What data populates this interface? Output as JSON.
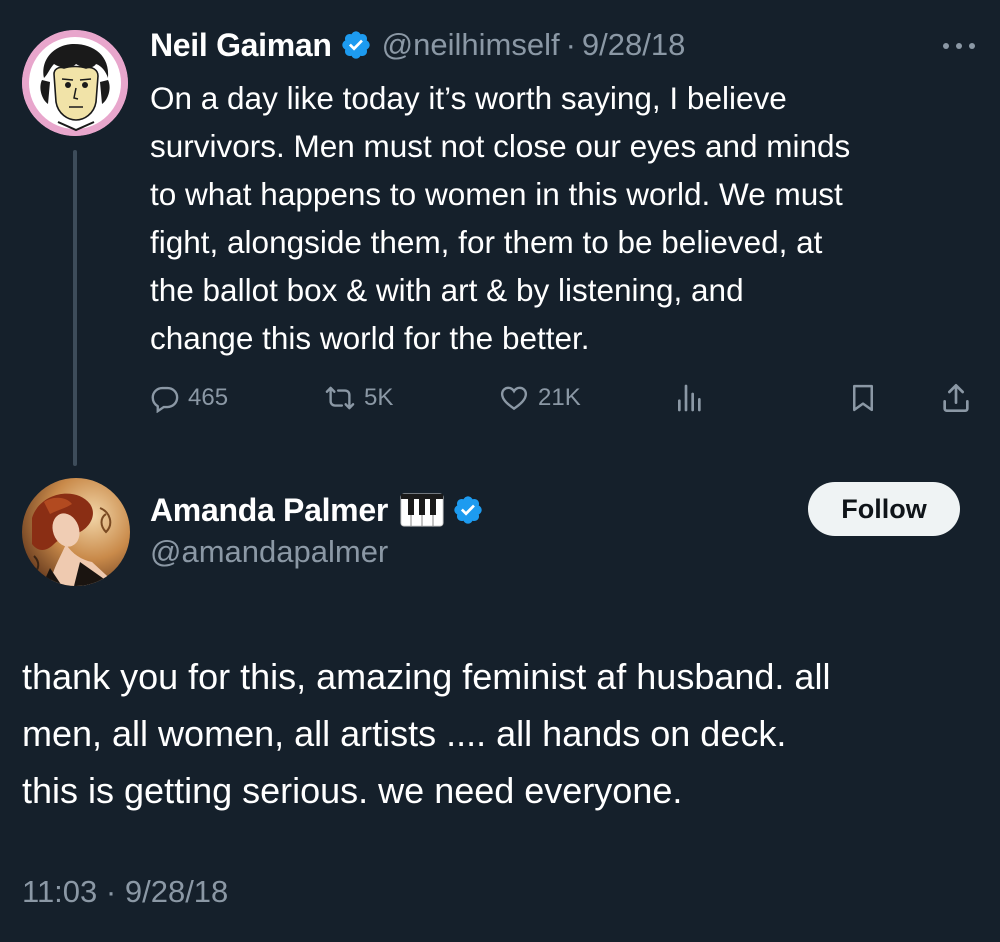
{
  "parent_tweet": {
    "author": {
      "display_name": "Neil Gaiman",
      "verified": true,
      "handle": "@neilhimself",
      "avatar_icon": "cartoon-portrait-avatar"
    },
    "separator": "·",
    "date": "9/28/18",
    "more_icon": "more-dots-icon",
    "text": "On a day like today it’s worth saying, I believe\nsurvivors. Men must not close our eyes and minds\nto what happens to women in this world. We must\nfight, alongside them, for them to be believed, at\nthe ballot box & with art & by listening, and\nchange this world for the better.",
    "actions": {
      "replies": "465",
      "retweets": "5K",
      "likes": "21K",
      "views_icon": "analytics-icon",
      "bookmark_icon": "bookmark-icon",
      "share_icon": "share-icon"
    }
  },
  "reply_tweet": {
    "author": {
      "display_name": "Amanda Palmer",
      "emoji": "🎹",
      "verified": true,
      "handle": "@amandapalmer",
      "avatar_icon": "photo-avatar"
    },
    "follow_label": "Follow",
    "text": "thank you for this, amazing feminist af husband. all\nmen, all women, all artists .... all hands on deck.\nthis is getting serious. we need everyone.",
    "time": "11:03",
    "separator": "·",
    "date": "9/28/18"
  },
  "colors": {
    "background": "#15202b",
    "text_primary": "#ffffff",
    "text_secondary": "#8b98a5",
    "verified_blue": "#1d9bf0",
    "thread_line": "#3d4c5a",
    "follow_button_bg": "#eff3f4"
  }
}
